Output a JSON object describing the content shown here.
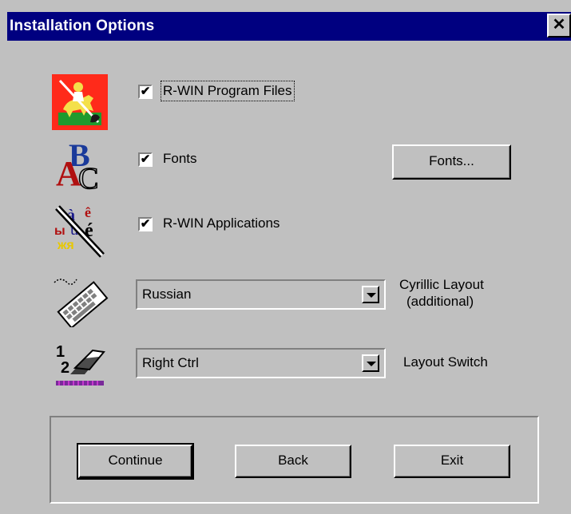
{
  "window": {
    "title": "Installation Options",
    "close_glyph": "✕"
  },
  "options": {
    "program_files": {
      "label": "R-WIN Program Files",
      "checked": true
    },
    "fonts": {
      "label": "Fonts",
      "checked": true,
      "button_label": "Fonts..."
    },
    "applications": {
      "label": "R-WIN Applications",
      "checked": true
    }
  },
  "check_glyph": "✔",
  "cyrillic_layout": {
    "selected": "Russian",
    "label_line1": "Cyrillic Layout",
    "label_line2": "(additional)"
  },
  "layout_switch": {
    "selected": "Right Ctrl",
    "label": "Layout Switch"
  },
  "buttons": {
    "continue": "Continue",
    "back": "Back",
    "exit": "Exit"
  },
  "icons": {
    "program_files": "st-george-icon",
    "fonts": "abc-fonts-icon",
    "applications": "cyrillic-chars-icon",
    "keyboard": "keyboard-icon",
    "switch": "layout-switch-icon"
  }
}
